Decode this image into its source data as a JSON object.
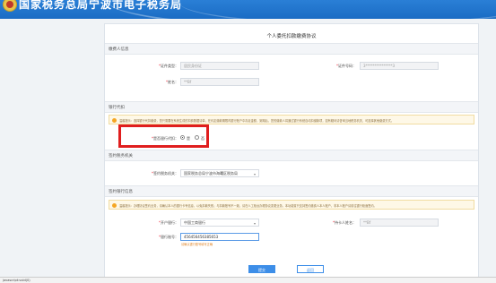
{
  "header": {
    "site_title": "国家税务总局宁波市电子税务局"
  },
  "form": {
    "title": "个人委托扣款缴费协议",
    "taxpayer": {
      "section": "缴费人信息",
      "id_type_label": "证件类型：",
      "id_type_value": "居民身份证",
      "id_no_label": "证件号码：",
      "id_no_value": "3***************3",
      "name_label": "姓名：",
      "name_value": "**Bf"
    },
    "bank_agent": {
      "section": "银行代扣",
      "notice": "温馨提示：选择银行代扣缴费，您只需要在系统生成的扣费数据清单，在约定缴款期限内银行账户中存足金额，到期后，您的缴款人将通过银行系统自动扣缴款项，如有疑问请咨询当地税务机关，可选择其他缴费方式。",
      "question": "是否银行代扣：",
      "option_yes": "是",
      "option_no": "否",
      "selected": "是"
    },
    "tax_office": {
      "section": "签约税务机关",
      "label": "签约税务机关：",
      "value": "国家税务总局宁波市海曙区税务局"
    },
    "bank_info": {
      "section": "签约银行信息",
      "notice": "温馨提示：办理协议签约业务，请确认本人的银行卡号信息，以免扣款失败；与扣款账号不一致，请在人工柜台办理协议变更业务。本功能暂只支持签约缴费人本人账户，非本人账户请前往银行柜面签约。",
      "bank_label": "开户银行：",
      "bank_value": "中国工商银行",
      "holder_label": "持卡人姓名：",
      "holder_value": "**Bf",
      "account_label": "银行账号：",
      "account_value": "456456456385653",
      "account_hint": "请确认银行账号填写正确"
    },
    "actions": {
      "submit": "提交",
      "back": "返回"
    }
  },
  "statusbar": {
    "text": "javascript:void(0)"
  }
}
